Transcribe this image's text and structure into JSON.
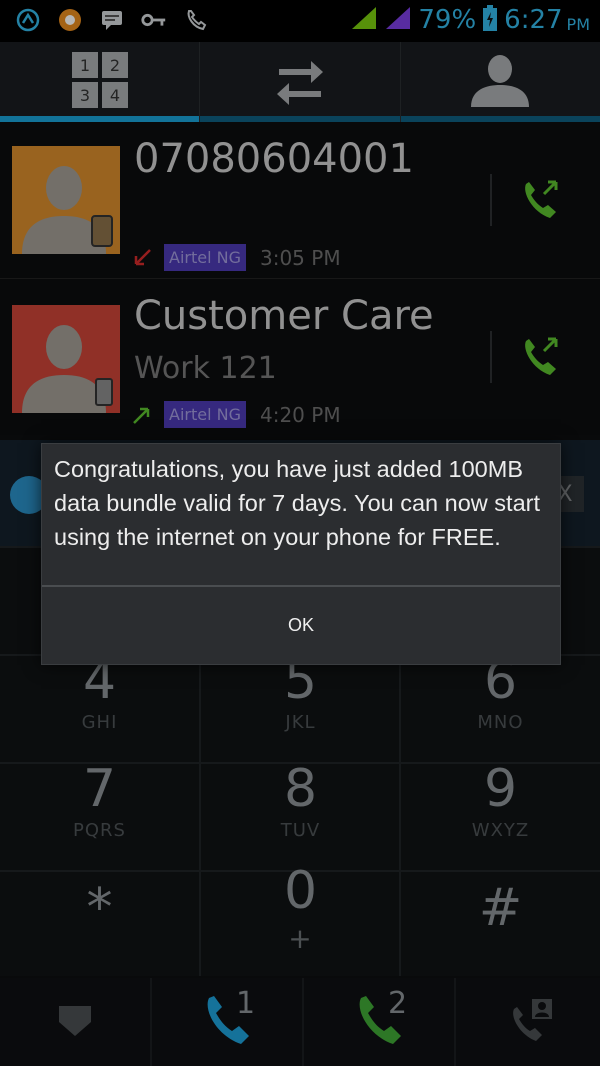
{
  "status_bar": {
    "icons": [
      "sync-icon",
      "app-icon",
      "message-icon",
      "key-icon",
      "missed-call-icon"
    ],
    "battery_percent": "79%",
    "time": "6:27",
    "ampm": "PM",
    "signal_color_sim1": "#79c90f",
    "signal_color_sim2": "#7a3de0"
  },
  "tabs": [
    {
      "name": "dialpad-tab",
      "icon": "dialpad-icon",
      "active": true
    },
    {
      "name": "call-log-tab",
      "icon": "swap-arrows-icon",
      "active": false
    },
    {
      "name": "contacts-tab",
      "icon": "person-icon",
      "active": false
    }
  ],
  "call_log": [
    {
      "name": "07080604001",
      "subtitle": "",
      "sim": "Airtel NG",
      "time": "3:05 PM",
      "direction": "incoming",
      "avatar_color": "#d48a2c"
    },
    {
      "name": "Customer Care",
      "subtitle": "Work 121",
      "sim": "Airtel NG",
      "time": "4:20 PM",
      "direction": "outgoing",
      "avatar_color": "#c84336"
    }
  ],
  "dialog": {
    "message": "Congratulations, you have just added 100MB data bundle valid for 7 days. You can now start using the internet on your phone for FREE.",
    "ok_label": "OK"
  },
  "hidden_bar": {
    "close_label": "X"
  },
  "dialpad": [
    {
      "digit": "4",
      "letters": "GHI"
    },
    {
      "digit": "5",
      "letters": "JKL"
    },
    {
      "digit": "6",
      "letters": "MNO"
    },
    {
      "digit": "7",
      "letters": "PQRS"
    },
    {
      "digit": "8",
      "letters": "TUV"
    },
    {
      "digit": "9",
      "letters": "WXYZ"
    },
    {
      "digit": "*",
      "letters": ""
    },
    {
      "digit": "0",
      "letters": "+"
    },
    {
      "digit": "#",
      "letters": ""
    }
  ],
  "bottom_bar": {
    "sim1_label": "1",
    "sim2_label": "2",
    "sim1_color": "#1e9fd6",
    "sim2_color": "#3fa535"
  }
}
